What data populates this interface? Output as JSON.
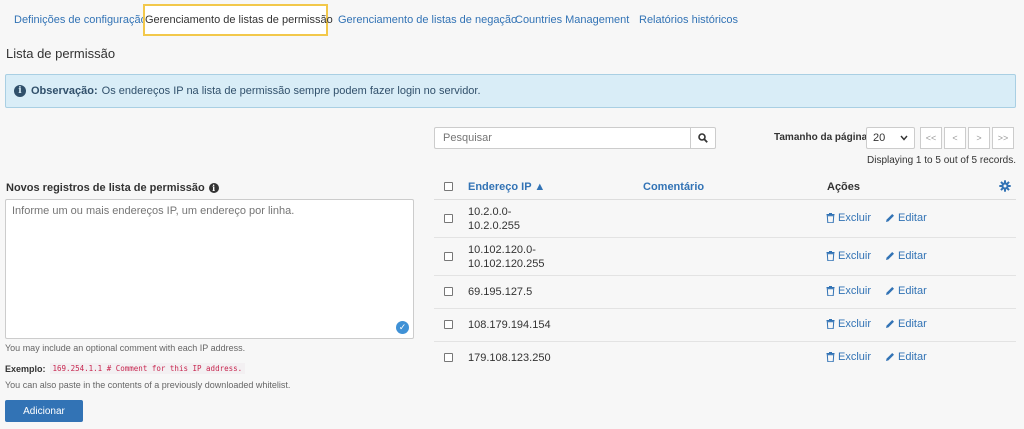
{
  "tabs": [
    {
      "label": "Definições de configuração"
    },
    {
      "label": "Gerenciamento de listas de permissão"
    },
    {
      "label": "Gerenciamento de listas de negação"
    },
    {
      "label": "Countries Management"
    },
    {
      "label": "Relatórios históricos"
    }
  ],
  "page_title": "Lista de permissão",
  "notice": {
    "label": "Observação:",
    "text": "Os endereços IP na lista de permissão sempre podem fazer login no servidor."
  },
  "form": {
    "label": "Novos registros de lista de permissão",
    "placeholder": "Informe um ou mais endereços IP, um endereço por linha.",
    "help1": "You may include an optional comment with each IP address.",
    "example_label": "Exemplo:",
    "example_code": "169.254.1.1 # Comment for this IP address.",
    "help2": "You can also paste in the contents of a previously downloaded whitelist.",
    "add_label": "Adicionar"
  },
  "search": {
    "placeholder": "Pesquisar"
  },
  "page_size": {
    "label": "Tamanho da página",
    "value": "20"
  },
  "pager": {
    "first": "<<",
    "prev": "<",
    "next": ">",
    "last": ">>"
  },
  "displaying": "Displaying 1 to 5 out of 5 records.",
  "table": {
    "col_ip": "Endereço IP ▲",
    "col_comment": "Comentário",
    "col_actions": "Ações",
    "delete_label": "Excluir",
    "edit_label": "Editar",
    "rows": [
      {
        "line1": "10.2.0.0-",
        "line2": "10.2.0.255"
      },
      {
        "line1": "10.102.120.0-",
        "line2": "10.102.120.255"
      },
      {
        "line1": "69.195.127.5",
        "line2": ""
      },
      {
        "line1": "108.179.194.154",
        "line2": ""
      },
      {
        "line1": "179.108.123.250",
        "line2": ""
      }
    ]
  },
  "colors": {
    "link": "#3273b5",
    "notice_bg": "#d9edf7",
    "highlight": "#f2c84b"
  },
  "icons": [
    "info-icon",
    "search-icon",
    "chevron-down-icon",
    "gear-icon",
    "trash-icon",
    "pencil-icon",
    "check-circle-icon"
  ]
}
